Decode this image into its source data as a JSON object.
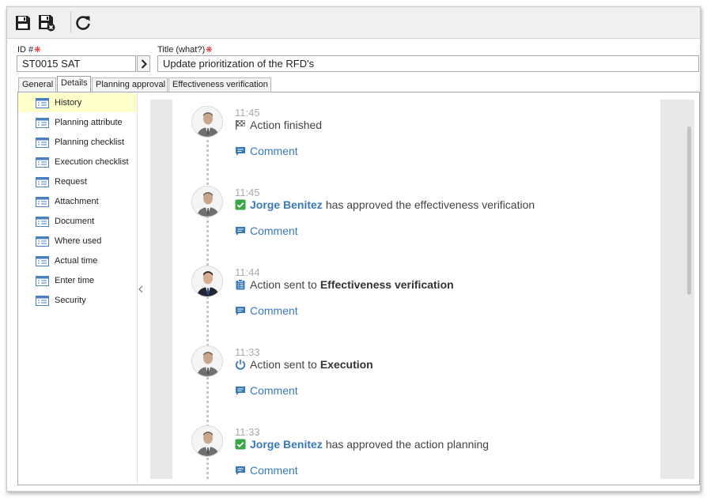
{
  "toolbar": {
    "save_icon": "save-icon",
    "save_close_icon": "save-and-close-icon",
    "refresh_icon": "refresh-icon"
  },
  "fields": {
    "id_label": "ID #",
    "id_value": "ST0015 SAT",
    "title_label": "Title (what?)",
    "title_value": "Update prioritization of the RFD's",
    "required_mark": "❋"
  },
  "tabs": [
    {
      "label": "General"
    },
    {
      "label": "Details"
    },
    {
      "label": "Planning approval"
    },
    {
      "label": "Effectiveness verification"
    }
  ],
  "sidebar": {
    "items": [
      {
        "label": "History"
      },
      {
        "label": "Planning attribute"
      },
      {
        "label": "Planning checklist"
      },
      {
        "label": "Execution checklist"
      },
      {
        "label": "Request"
      },
      {
        "label": "Attachment"
      },
      {
        "label": "Document"
      },
      {
        "label": "Where used"
      },
      {
        "label": "Actual time"
      },
      {
        "label": "Enter time"
      },
      {
        "label": "Security"
      }
    ],
    "selected": "History"
  },
  "timeline": {
    "comment_label": "Comment",
    "entries": [
      {
        "time": "11:45",
        "icon": "checkered-flag-icon",
        "user": "",
        "text": "Action finished",
        "target": ""
      },
      {
        "time": "11:45",
        "icon": "approved-check-icon",
        "user": "Jorge Benitez",
        "text": "has approved the effectiveness verification",
        "target": ""
      },
      {
        "time": "11:44",
        "icon": "clipboard-icon",
        "user": "",
        "text": "Action sent to",
        "target": "Effectiveness verification"
      },
      {
        "time": "11:33",
        "icon": "power-icon",
        "user": "",
        "text": "Action sent to",
        "target": "Execution"
      },
      {
        "time": "11:33",
        "icon": "approved-check-icon",
        "user": "Jorge Benitez",
        "text": "has approved the action planning",
        "target": ""
      }
    ]
  },
  "colors": {
    "link": "#3a79b8",
    "selected_row": "#ffffcc",
    "approved": "#3aa645",
    "required": "#dd2222"
  }
}
